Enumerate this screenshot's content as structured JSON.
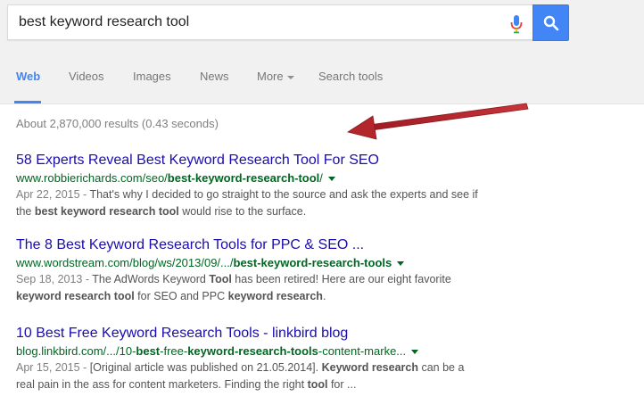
{
  "search": {
    "query": "best keyword research tool"
  },
  "colors": {
    "search_button": "#4285f4",
    "link": "#1a0dab",
    "url": "#006621",
    "arrow": "#c0272d"
  },
  "nav": {
    "tabs": [
      {
        "label": "Web",
        "active": true
      },
      {
        "label": "Videos"
      },
      {
        "label": "Images"
      },
      {
        "label": "News"
      },
      {
        "label": "More"
      },
      {
        "label": "Search tools"
      }
    ]
  },
  "stats": "About 2,870,000 results (0.43 seconds)",
  "results": [
    {
      "title": "58 Experts Reveal Best Keyword Research Tool For SEO",
      "url_prefix": "www.robbierichards.com/seo/",
      "url_bold": "best-keyword-research-tool",
      "url_suffix": "/",
      "date": "Apr 22, 2015 - ",
      "snip1": "That's why I decided to go straight to the source and ask the experts and see if the ",
      "snip1_bold": "best keyword research tool",
      "snip2": " would rise to the surface."
    },
    {
      "title": "The 8 Best Keyword Research Tools for PPC & SEO ...",
      "url_prefix": "www.wordstream.com/blog/ws/2013/09/.../",
      "url_bold": "best-keyword-research-tools",
      "url_suffix": "",
      "date": "Sep 18, 2013 - ",
      "snip1": "The AdWords Keyword ",
      "snip1_bold": "Tool",
      "snip2": " has been retired! Here are our eight favorite ",
      "snip2_bold": "keyword research tool",
      "snip3": " for SEO and PPC ",
      "snip3_bold": "keyword research",
      "snip4": "."
    },
    {
      "title": "10 Best Free Keyword Research Tools - linkbird blog",
      "url_prefix": "blog.linkbird.com/.../10-",
      "url_bold": "best",
      "url_mid1": "-free-",
      "url_bold2": "keyword-research-tools",
      "url_suffix": "-content-marke...",
      "date": "Apr 15, 2015 - ",
      "snip1": "[Original article was published on 21.05.2014]. ",
      "snip1_bold": "Keyword research",
      "snip2": " can be a real pain in the ass for content marketers. Finding the right ",
      "snip2_bold": "tool",
      "snip3": " for ..."
    }
  ]
}
